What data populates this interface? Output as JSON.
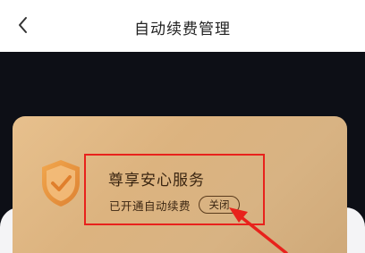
{
  "header": {
    "title": "自动续费管理",
    "back_icon": "chevron-left-icon"
  },
  "card": {
    "icon": "shield-check-icon",
    "title": "尊享安心服务",
    "status_text": "已开通自动续费",
    "close_label": "关闭"
  },
  "annotation": {
    "box_color": "#e8221c",
    "arrow_color": "#e8221c"
  },
  "colors": {
    "dark_band": "#0d0f16",
    "card_gold": "#dcb37f",
    "shield_orange": "#e8963e"
  }
}
